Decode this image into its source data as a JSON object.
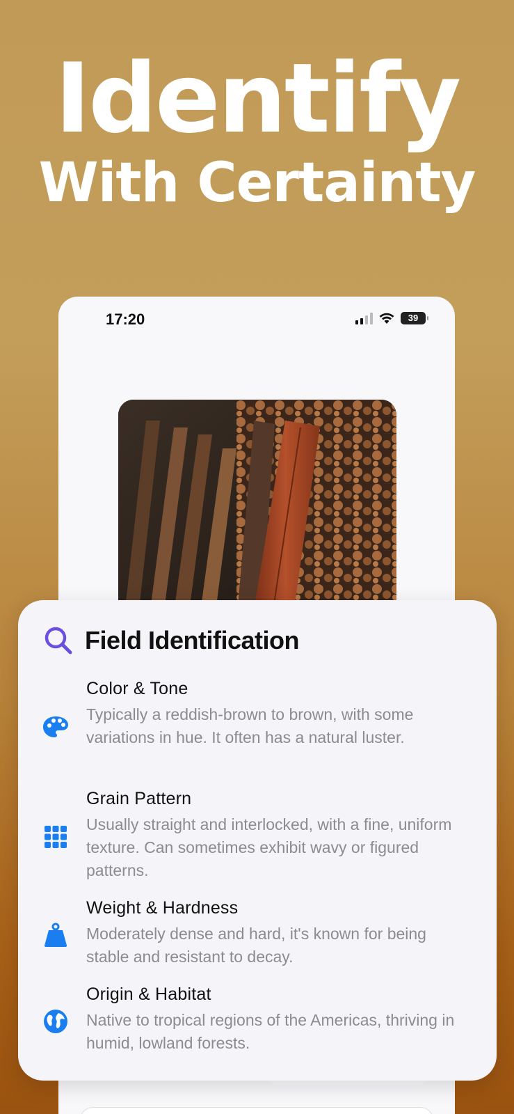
{
  "headline": {
    "line1": "Identify",
    "line2": "With Certainty"
  },
  "status_bar": {
    "time": "17:20",
    "battery": "39",
    "icons": [
      "signal-icon",
      "wifi-icon",
      "battery-icon"
    ]
  },
  "photo": {
    "subject": "stacked-wood-image"
  },
  "card": {
    "title": "Field Identification",
    "title_icon": "magnifier-icon",
    "accent_color": "#6a4fe0",
    "icon_color": "#1a7ef0",
    "items": [
      {
        "icon": "palette-icon",
        "title": "Color & Tone",
        "description": "Typically a reddish-brown to brown, with some variations in hue. It often has a natural luster."
      },
      {
        "icon": "grid-icon",
        "title": "Grain Pattern",
        "description": "Usually straight and interlocked, with a fine, uniform texture. Can sometimes exhibit wavy or figured patterns."
      },
      {
        "icon": "weight-icon",
        "title": "Weight & Hardness",
        "description": "Moderately dense and hard, it's known for being stable and resistant to decay."
      },
      {
        "icon": "globe-icon",
        "title": "Origin & Habitat",
        "description": "Native to tropical regions of the Americas, thriving in humid, lowland forests."
      }
    ]
  }
}
